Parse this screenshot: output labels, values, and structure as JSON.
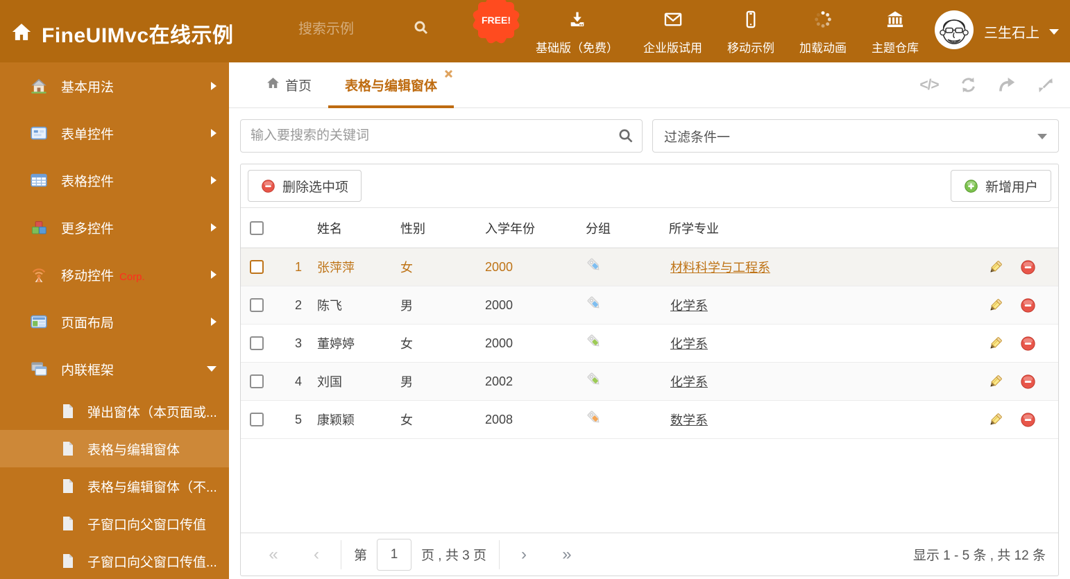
{
  "header": {
    "title": "FineUIMvc在线示例",
    "search_placeholder": "搜索示例",
    "free_badge": "FREE!",
    "nav_items": [
      {
        "icon": "download-icon",
        "label": "基础版（免费）"
      },
      {
        "icon": "envelope-icon",
        "label": "企业版试用"
      },
      {
        "icon": "mobile-icon",
        "label": "移动示例"
      },
      {
        "icon": "spinner-icon",
        "label": "加载动画"
      },
      {
        "icon": "bank-icon",
        "label": "主题仓库"
      }
    ],
    "user": {
      "name": "三生石上"
    }
  },
  "sidebar": {
    "items": [
      {
        "label": "基本用法"
      },
      {
        "label": "表单控件"
      },
      {
        "label": "表格控件"
      },
      {
        "label": "更多控件"
      },
      {
        "label": "移动控件",
        "badge": "Corp."
      },
      {
        "label": "页面布局"
      },
      {
        "label": "内联框架",
        "expanded": true
      }
    ],
    "subitems": [
      {
        "label": "弹出窗体（本页面或..."
      },
      {
        "label": "表格与编辑窗体",
        "active": true
      },
      {
        "label": "表格与编辑窗体（不..."
      },
      {
        "label": "子窗口向父窗口传值"
      },
      {
        "label": "子窗口向父窗口传值..."
      }
    ]
  },
  "tabs": [
    {
      "label": "首页"
    },
    {
      "label": "表格与编辑窗体",
      "active": true
    }
  ],
  "filter": {
    "search_placeholder": "输入要搜索的关键词",
    "selected": "过滤条件一"
  },
  "toolbar": {
    "delete_label": "删除选中项",
    "add_label": "新增用户"
  },
  "table": {
    "columns": [
      "姓名",
      "性别",
      "入学年份",
      "分组",
      "所学专业"
    ],
    "rows": [
      {
        "num": "1",
        "name": "张萍萍",
        "gender": "女",
        "year": "2000",
        "tag": "blue",
        "major": "材料科学与工程系",
        "selected": true
      },
      {
        "num": "2",
        "name": "陈飞",
        "gender": "男",
        "year": "2000",
        "tag": "blue",
        "major": "化学系"
      },
      {
        "num": "3",
        "name": "董婷婷",
        "gender": "女",
        "year": "2000",
        "tag": "green",
        "major": "化学系"
      },
      {
        "num": "4",
        "name": "刘国",
        "gender": "男",
        "year": "2002",
        "tag": "green",
        "major": "化学系"
      },
      {
        "num": "5",
        "name": "康颖颖",
        "gender": "女",
        "year": "2008",
        "tag": "orange",
        "major": "数学系"
      }
    ]
  },
  "pagination": {
    "page_label_before": "第",
    "page_value": "1",
    "page_label_after": "页 , 共 3 页",
    "summary": "显示 1 - 5 条 , 共 12 条"
  },
  "colors": {
    "header_bg": "#B2690F",
    "sidebar_bg": "#C0741C",
    "sidebar_active_bg": "#CD8838",
    "tab_active": "#BE6B10",
    "selected_row_text": "#BE7316",
    "free_badge": "#FF4B1F",
    "delete_red": "#E2574C",
    "add_green": "#6CBB3C",
    "tag_blue": "#7FBEF0",
    "tag_green": "#9DCB56",
    "tag_orange": "#F5A656"
  }
}
